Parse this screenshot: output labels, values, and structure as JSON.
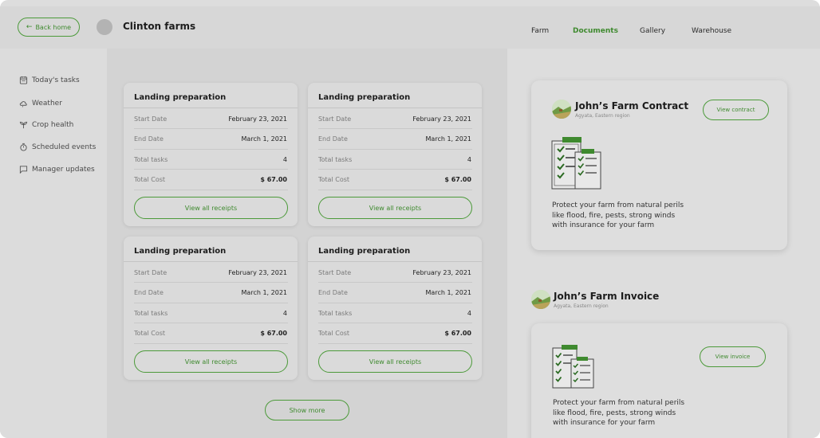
{
  "header": {
    "back_label": "Back home",
    "farm_name": "Clinton farms",
    "nav": [
      "Farm",
      "Documents",
      "Gallery",
      "Warehouse"
    ],
    "active_nav": "Documents"
  },
  "sidebar": {
    "items": [
      {
        "label": "Today's tasks",
        "icon": "calendar-icon"
      },
      {
        "label": "Weather",
        "icon": "cloud-icon"
      },
      {
        "label": "Crop health",
        "icon": "plant-icon"
      },
      {
        "label": "Scheduled events",
        "icon": "timer-icon"
      },
      {
        "label": "Manager updates",
        "icon": "chat-icon"
      }
    ]
  },
  "cards": [
    {
      "title": "Landing preparation",
      "rows": [
        {
          "label": "Start Date",
          "value": "February 23, 2021"
        },
        {
          "label": "End Date",
          "value": "March 1, 2021"
        },
        {
          "label": "Total tasks",
          "value": "4"
        },
        {
          "label": "Total Cost",
          "value": "$ 67.00"
        }
      ],
      "button": "View all receipts"
    },
    {
      "title": "Landing preparation",
      "rows": [
        {
          "label": "Start Date",
          "value": "February 23, 2021"
        },
        {
          "label": "End Date",
          "value": "March 1, 2021"
        },
        {
          "label": "Total tasks",
          "value": "4"
        },
        {
          "label": "Total Cost",
          "value": "$ 67.00"
        }
      ],
      "button": "View all receipts"
    },
    {
      "title": "Landing preparation",
      "rows": [
        {
          "label": "Start Date",
          "value": "February 23, 2021"
        },
        {
          "label": "End Date",
          "value": "March 1, 2021"
        },
        {
          "label": "Total tasks",
          "value": "4"
        },
        {
          "label": "Total Cost",
          "value": "$ 67.00"
        }
      ],
      "button": "View all receipts"
    },
    {
      "title": "Landing preparation",
      "rows": [
        {
          "label": "Start Date",
          "value": "February 23, 2021"
        },
        {
          "label": "End Date",
          "value": "March 1, 2021"
        },
        {
          "label": "Total tasks",
          "value": "4"
        },
        {
          "label": "Total Cost",
          "value": "$ 67.00"
        }
      ],
      "button": "View all receipts"
    }
  ],
  "show_more_label": "Show more",
  "documents": {
    "contract": {
      "title": "John’s Farm Contract",
      "subtitle": "Agyata, Eastern region",
      "button": "View contract",
      "description": "Protect your farm from natural perils like flood, fire, pests, strong winds with insurance for your farm"
    },
    "invoice": {
      "title": "John’s Farm Invoice",
      "subtitle": "Agyata, Eastern region",
      "button": "View invoice",
      "description": "Protect your farm from natural perils like flood, fire, pests, strong winds with insurance for your farm"
    }
  },
  "colors": {
    "accent": "#3f8a2f",
    "background": "#dddddd"
  }
}
